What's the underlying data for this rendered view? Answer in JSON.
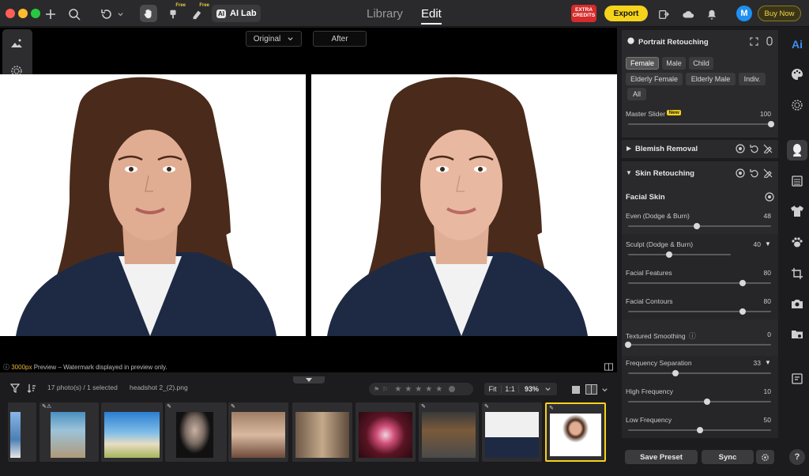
{
  "topbar": {
    "ai_lab_label": "AI Lab",
    "free_badge_1": "Free",
    "free_badge_2": "Free",
    "tab_library": "Library",
    "tab_edit": "Edit",
    "extra_credits": "EXTRA CREDITS",
    "export_label": "Export",
    "avatar_letter": "M",
    "buy_now_label": "Buy Now",
    "colors": {
      "export": "#f5d21b",
      "buy_now": "#3b3518",
      "avatar": "#1f8ff0"
    }
  },
  "viewer": {
    "original_select": "Original",
    "after_label": "After",
    "preview_size": "3000px",
    "preview_text": "Preview – Watermark displayed in preview only."
  },
  "filmstrip": {
    "photo_count": "17 photo(s) / 1 selected",
    "filename": "headshot 2_(2).png",
    "fit_label": "Fit",
    "one_to_one": "1:1",
    "zoom": "93%",
    "stars": [
      "★",
      "★",
      "★",
      "★",
      "★"
    ]
  },
  "panel": {
    "title": "Portrait Retouching",
    "genders": [
      "Female",
      "Male",
      "Child"
    ],
    "genders2": [
      "Elderly Female",
      "Elderly Male",
      "Indiv."
    ],
    "all_label": "All",
    "master_slider_label": "Master Slider",
    "new_badge": "New",
    "master_value": "100",
    "master_level": 1.0,
    "blemish_label": "Blemish Removal",
    "skin_label": "Skin Retouching",
    "facial_skin_label": "Facial Skin",
    "sliders": [
      {
        "label": "Even (Dodge & Burn)",
        "value": "48",
        "level": 0.48
      },
      {
        "label": "Sculpt (Dodge & Burn)",
        "value": "40",
        "level": 0.4
      },
      {
        "label": "Facial Features",
        "value": "80",
        "level": 0.8
      },
      {
        "label": "Facial Contours",
        "value": "80",
        "level": 0.8
      },
      {
        "label": "Textured Smoothing",
        "value": "0",
        "level": 0.0
      },
      {
        "label": "Frequency Separation",
        "value": "33",
        "level": 0.33
      },
      {
        "label": "High Frequency",
        "value": "10",
        "level": 0.55
      },
      {
        "label": "Low Frequency",
        "value": "50",
        "level": 0.5
      }
    ],
    "save_preset_label": "Save Preset",
    "sync_label": "Sync"
  },
  "right_toolbar": {
    "ai_label": "Ai",
    "help_label": "?"
  }
}
